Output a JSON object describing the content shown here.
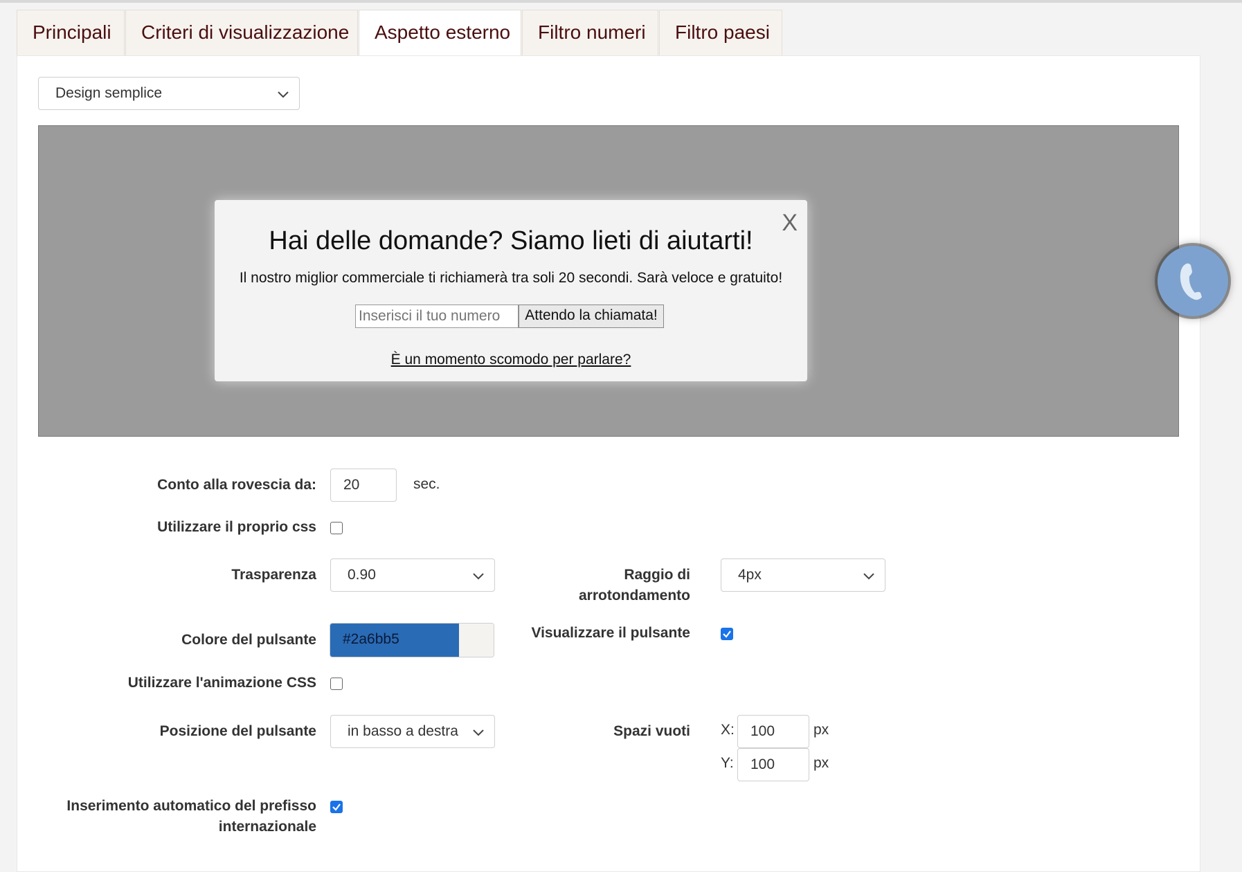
{
  "tabs": [
    "Principali",
    "Criteri di visualizzazione",
    "Aspetto esterno",
    "Filtro numeri",
    "Filtro paesi"
  ],
  "active_tab": "Aspetto esterno",
  "design_select": "Design semplice",
  "preview": {
    "close": "X",
    "title": "Hai delle domande? Siamo lieti di aiutarti!",
    "subtitle": "Il nostro miglior commerciale ti richiamerà tra soli 20 secondi. Sarà veloce e gratuito!",
    "input_placeholder": "Inserisci il tuo numero",
    "button": "Attendo la chiamata!",
    "link": "È un momento scomodo per parlare?"
  },
  "form": {
    "countdown_label": "Conto alla rovescia da:",
    "countdown_value": "20",
    "countdown_unit": "sec.",
    "own_css_label": "Utilizzare il proprio css",
    "own_css_checked": false,
    "transparency_label": "Trasparenza",
    "transparency_value": "0.90",
    "radius_label_1": "Raggio di",
    "radius_label_2": "arrotondamento",
    "radius_value": "4px",
    "button_color_label": "Colore del pulsante",
    "button_color_value": "#2a6bb5",
    "show_button_label": "Visualizzare il pulsante",
    "show_button_checked": true,
    "css_anim_label": "Utilizzare l'animazione CSS",
    "css_anim_checked": false,
    "button_position_label": "Posizione del pulsante",
    "button_position_value": "in basso a destra",
    "gaps_label": "Spazi vuoti",
    "gap_x_label": "X:",
    "gap_x_value": "100",
    "gap_y_label": "Y:",
    "gap_y_value": "100",
    "px_unit": "px",
    "auto_prefix_label_1": "Inserimento automatico del prefisso",
    "auto_prefix_label_2": "internazionale",
    "auto_prefix_checked": true
  },
  "colors": {
    "button_color": "#2a6bb5",
    "tab_text": "#4a0e0e",
    "checkbox_on": "#1a73e8"
  }
}
